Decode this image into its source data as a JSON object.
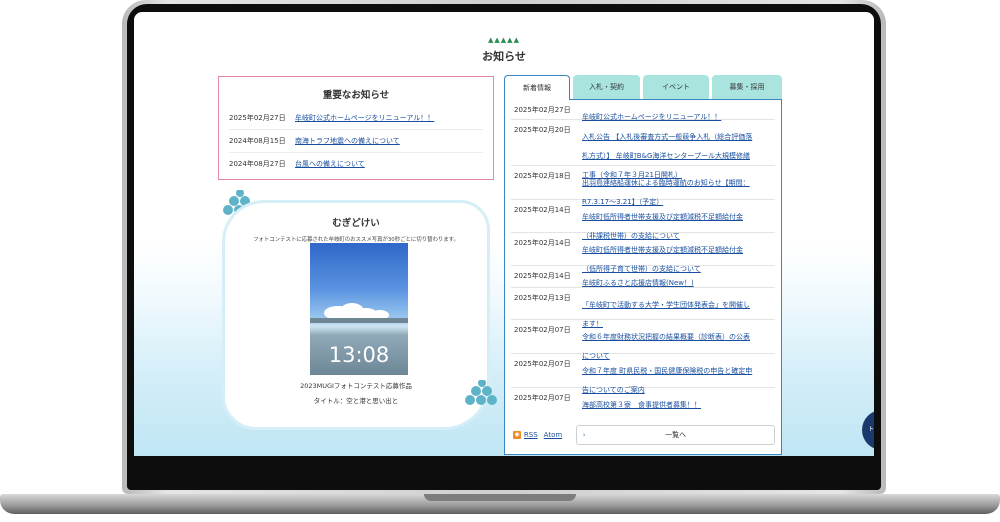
{
  "section": {
    "title": "お知らせ",
    "triangles": "▲▲▲▲▲"
  },
  "important": {
    "title": "重要なお知らせ",
    "items": [
      {
        "date": "2025年02月27日",
        "text": "牟岐町公式ホームページをリニューアル！！"
      },
      {
        "date": "2024年08月15日",
        "text": "南海トラフ地震への備えについて"
      },
      {
        "date": "2024年08月27日",
        "text": "台風への備えについて"
      }
    ]
  },
  "mugi": {
    "title": "むぎどけい",
    "description": "フォトコンテストに応募された牟岐町のおススメ写真が30秒ごとに切り替わります。",
    "time": "13:08",
    "caption_line1": "2023MUGIフォトコンテスト応募作品",
    "caption_line2": "タイトル：空と港と思い出と"
  },
  "tabs": [
    {
      "label": "新着情報"
    },
    {
      "label": "入札・契約"
    },
    {
      "label": "イベント"
    },
    {
      "label": "募集・採用"
    }
  ],
  "news": [
    {
      "date": "2025年02月27日",
      "text": [
        "牟岐町公式ホームページをリニューアル！！"
      ]
    },
    {
      "date": "2025年02月20日",
      "text": [
        "入札公告 【入札後審査方式一般競争入札（総合評価落",
        "札方式）】 牟岐町B&G海洋センタープール大規模修繕",
        "工事（令和７年３月21日開札）"
      ]
    },
    {
      "date": "2025年02月18日",
      "text": [
        "出羽島連絡船運休による臨時運航のお知らせ【期間：",
        "R7.3.17～3.21】（予定）"
      ]
    },
    {
      "date": "2025年02月14日",
      "text": [
        "牟岐町低所得者世帯支援及び定額減税不足額給付金",
        "（非課税世帯）の支給について"
      ]
    },
    {
      "date": "2025年02月14日",
      "text": [
        "牟岐町低所得者世帯支援及び定額減税不足額給付金",
        "（低所得子育て世帯）の支給について"
      ]
    },
    {
      "date": "2025年02月14日",
      "text": [
        "牟岐町ふるさと応援店情報(New！)"
      ]
    },
    {
      "date": "2025年02月13日",
      "text": [
        "「牟岐町で活動する大学・学生団体発表会」を開催し",
        "ます！"
      ]
    },
    {
      "date": "2025年02月07日",
      "text": [
        "令和６年度財務状況把握の結果概要（診断表）の公表",
        "について"
      ]
    },
    {
      "date": "2025年02月07日",
      "text": [
        "令和７年度 町県民税・国民健康保険税の申告と確定申",
        "告についてのご案内"
      ]
    },
    {
      "date": "2025年02月07日",
      "text": [
        "海部高校第３寮　食事提供者募集！！"
      ]
    }
  ],
  "feeds": {
    "rss": "RSS",
    "atom": "Atom"
  },
  "more": {
    "label": "一覧へ",
    "chevron": "›"
  },
  "fab": {
    "label": "ト"
  }
}
